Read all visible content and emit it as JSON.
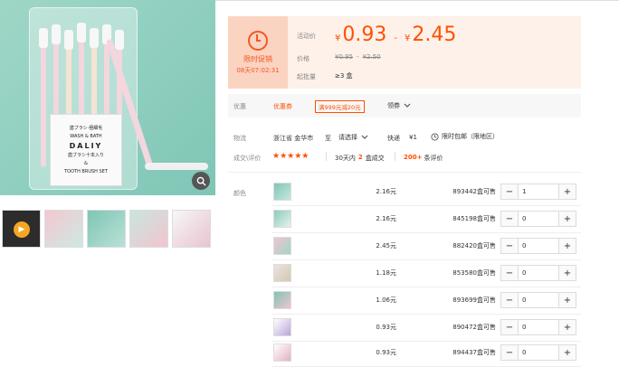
{
  "product": {
    "card_lines": [
      "歯ブラシ·極細毛",
      "WASH & BATH",
      "DALIY",
      "歯ブラシ十本入り",
      "&",
      "TOOTH BRUSH SET"
    ],
    "zoom_icon": "magnifier-icon",
    "video_icon": "play-icon"
  },
  "promo": {
    "label": "限时促销",
    "countdown": "08天07:02:31",
    "icon": "alarm-clock-icon"
  },
  "price": {
    "activity_label": "活动价",
    "currency": "¥",
    "low": "0.93",
    "separator": "-",
    "high": "2.45",
    "orig_label": "价格",
    "orig_low": "¥0.95",
    "orig_sep": "-",
    "orig_high": "¥2.50",
    "min_label": "起批量",
    "min_value": "≥3 盒"
  },
  "coupon": {
    "label": "优惠",
    "tag": "优惠券",
    "offer": "满999元减20元",
    "get_label": "领券",
    "chevron_icon": "chevron-down-icon"
  },
  "logistics": {
    "label": "物流",
    "from": "浙江省 金华市",
    "to_label": "至",
    "dest": "请选择",
    "express": "快递",
    "fee": "¥1",
    "shipping": "限时包邮（限地区）",
    "clock_icon": "clock-icon"
  },
  "reviews": {
    "label": "成交\\评价",
    "stars": "★★★★★",
    "deals_prefix": "30天内",
    "deals_count": "2",
    "deals_suffix": "盒成交",
    "review_count": "200+",
    "review_suffix": "条评价"
  },
  "sku": {
    "label": "颜色",
    "rows": [
      {
        "price": "2.16元",
        "stock": "893442盒可售",
        "qty": "1"
      },
      {
        "price": "2.16元",
        "stock": "845198盒可售",
        "qty": "0"
      },
      {
        "price": "2.45元",
        "stock": "882420盒可售",
        "qty": "0"
      },
      {
        "price": "1.18元",
        "stock": "853580盒可售",
        "qty": "0"
      },
      {
        "price": "1.06元",
        "stock": "893699盒可售",
        "qty": "0"
      },
      {
        "price": "0.93元",
        "stock": "890472盒可售",
        "qty": "0"
      },
      {
        "price": "0.93元",
        "stock": "894437盒可售",
        "qty": "0"
      }
    ],
    "minus": "−",
    "plus": "+"
  },
  "colors": {
    "accent": "#ff5000",
    "promo_bg": "#fbd3c1",
    "price_bg": "#fdf1ea"
  }
}
